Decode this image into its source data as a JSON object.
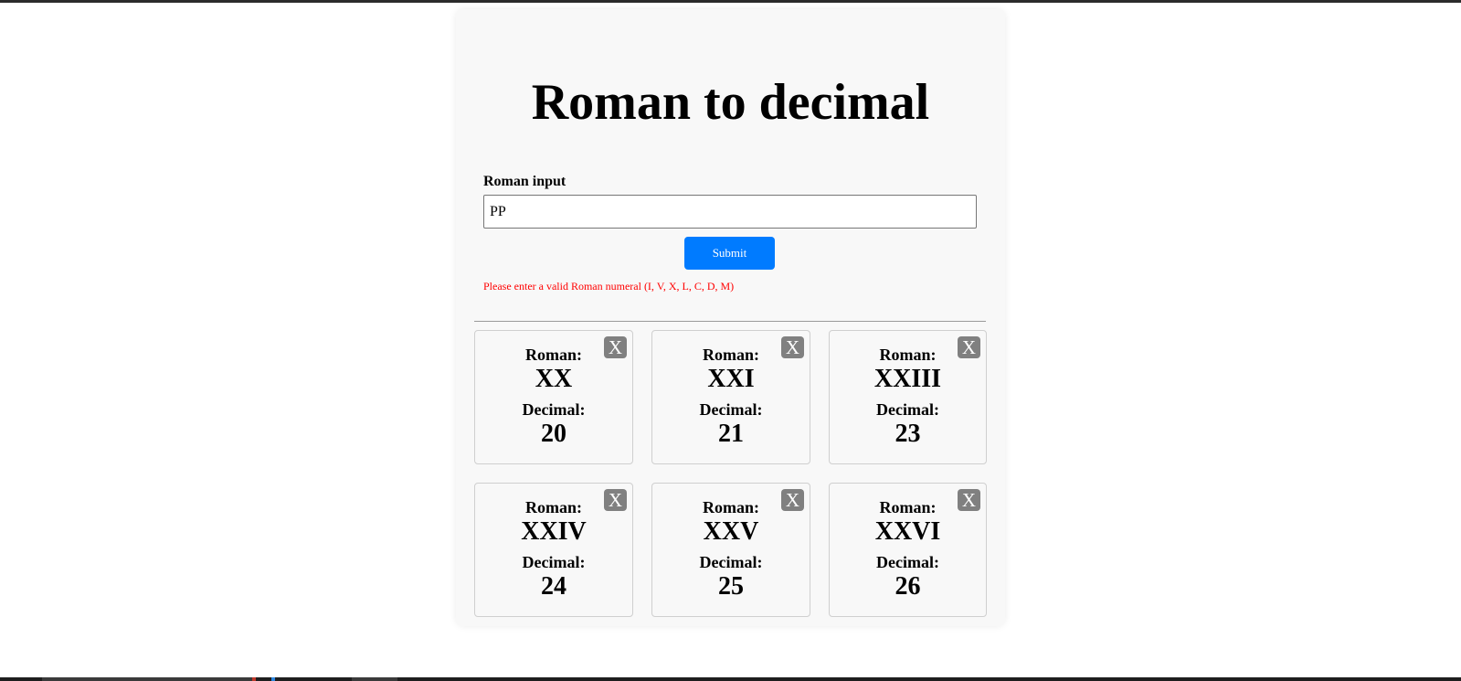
{
  "page": {
    "title": "Roman to decimal"
  },
  "form": {
    "input_label": "Roman input",
    "input_value": "PP",
    "submit_label": "Submit",
    "error_message": "Please enter a valid Roman numeral (I, V, X, L, C, D, M)"
  },
  "results": [
    {
      "roman_label": "Roman:",
      "roman": "XX",
      "decimal_label": "Decimal:",
      "decimal": "20",
      "close_label": "X"
    },
    {
      "roman_label": "Roman:",
      "roman": "XXI",
      "decimal_label": "Decimal:",
      "decimal": "21",
      "close_label": "X"
    },
    {
      "roman_label": "Roman:",
      "roman": "XXIII",
      "decimal_label": "Decimal:",
      "decimal": "23",
      "close_label": "X"
    },
    {
      "roman_label": "Roman:",
      "roman": "XXIV",
      "decimal_label": "Decimal:",
      "decimal": "24",
      "close_label": "X"
    },
    {
      "roman_label": "Roman:",
      "roman": "XXV",
      "decimal_label": "Decimal:",
      "decimal": "25",
      "close_label": "X"
    },
    {
      "roman_label": "Roman:",
      "roman": "XXVI",
      "decimal_label": "Decimal:",
      "decimal": "26",
      "close_label": "X"
    }
  ],
  "colors": {
    "accent": "#007bff",
    "error": "#ff0000",
    "close_button": "#808080",
    "card_background": "#f8f8f8"
  }
}
